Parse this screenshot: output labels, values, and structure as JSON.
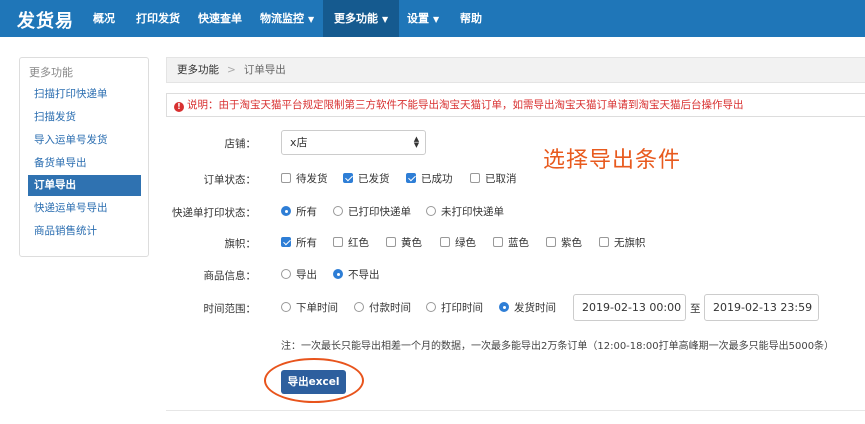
{
  "app": {
    "brand": "发货易"
  },
  "nav": {
    "items": [
      {
        "label": "概况"
      },
      {
        "label": "打印发货"
      },
      {
        "label": "快速查单"
      },
      {
        "label": "物流监控",
        "caret": "▼"
      },
      {
        "label": "更多功能",
        "caret": "▼"
      },
      {
        "label": "设置",
        "caret": "▼"
      },
      {
        "label": "帮助"
      }
    ]
  },
  "sidebar": {
    "title": "更多功能",
    "items": [
      {
        "label": "扫描打印快递单"
      },
      {
        "label": "扫描发货"
      },
      {
        "label": "导入运单号发货"
      },
      {
        "label": "备货单导出"
      },
      {
        "label": "订单导出"
      },
      {
        "label": "快递运单号导出"
      },
      {
        "label": "商品销售统计"
      }
    ]
  },
  "breadcrumb": {
    "parent": "更多功能",
    "sep": ">",
    "current": "订单导出"
  },
  "notice": {
    "icon": "!",
    "text": "说明：由于淘宝天猫平台规定限制第三方软件不能导出淘宝天猫订单，如需导出淘宝天猫订单请到淘宝天猫后台操作导出"
  },
  "form": {
    "shop": {
      "label": "店铺：",
      "value": "x店",
      "arrows": "▲▼"
    },
    "order_status": {
      "label": "订单状态：",
      "options": [
        {
          "label": "待发货",
          "checked": false
        },
        {
          "label": "已发货",
          "checked": true
        },
        {
          "label": "已成功",
          "checked": true
        },
        {
          "label": "已取消",
          "checked": false
        }
      ]
    },
    "print_status": {
      "label": "快递单打印状态：",
      "options": [
        {
          "label": "所有",
          "checked": true
        },
        {
          "label": "已打印快递单",
          "checked": false
        },
        {
          "label": "未打印快递单",
          "checked": false
        }
      ]
    },
    "flag": {
      "label": "旗帜：",
      "options": [
        {
          "label": "所有",
          "checked": true
        },
        {
          "label": "红色",
          "checked": false
        },
        {
          "label": "黄色",
          "checked": false
        },
        {
          "label": "绿色",
          "checked": false
        },
        {
          "label": "蓝色",
          "checked": false
        },
        {
          "label": "紫色",
          "checked": false
        },
        {
          "label": "无旗帜",
          "checked": false
        }
      ]
    },
    "product_info": {
      "label": "商品信息：",
      "options": [
        {
          "label": "导出",
          "checked": false
        },
        {
          "label": "不导出",
          "checked": true
        }
      ]
    },
    "time_range": {
      "label": "时间范围：",
      "options": [
        {
          "label": "下单时间",
          "checked": false
        },
        {
          "label": "付款时间",
          "checked": false
        },
        {
          "label": "打印时间",
          "checked": false
        },
        {
          "label": "发货时间",
          "checked": true
        }
      ],
      "start": "2019-02-13 00:00",
      "to": "至",
      "end": "2019-02-13 23:59"
    },
    "note": "注：一次最长只能导出相差一个月的数据，一次最多能导出2万条订单（12:00-18:00打单高峰期一次最多只能导出5000条）",
    "export_button": "导出excel"
  },
  "annotation": {
    "text": "选择导出条件",
    "color": "#e8541c"
  },
  "colors": {
    "topbar": "#1f76b8",
    "nav_active": "#155a8f",
    "sidebar_active": "#2f72b1",
    "notice": "#d83030",
    "control_checked": "#2e7ed6",
    "button": "#2d5f9e"
  }
}
